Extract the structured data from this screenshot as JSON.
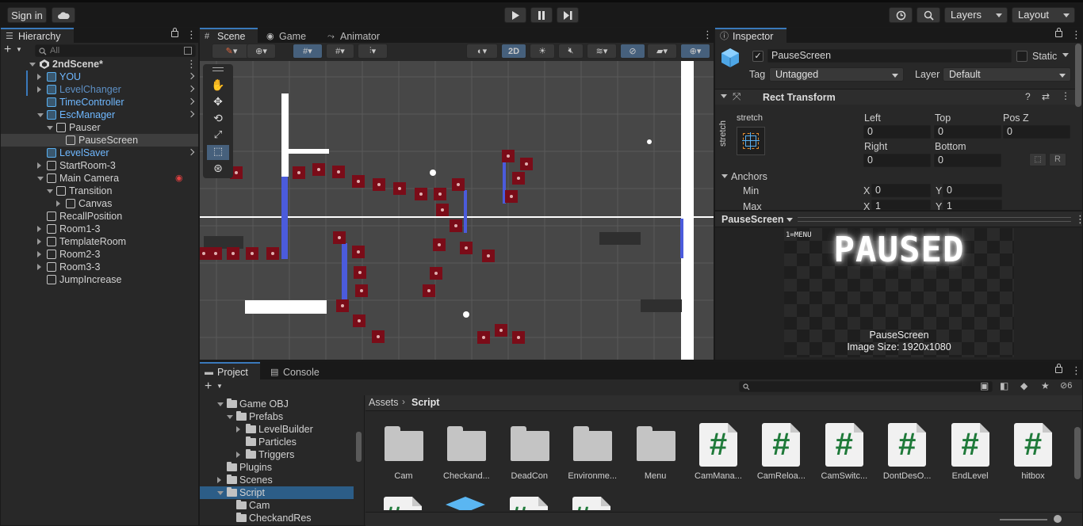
{
  "toolbar": {
    "sign_in": "Sign in",
    "layers": "Layers",
    "layout": "Layout"
  },
  "hierarchy": {
    "tab": "Hierarchy",
    "search_placeholder": "All",
    "scene_name": "2ndScene*",
    "items": [
      {
        "label": "YOU",
        "color": "blue"
      },
      {
        "label": "LevelChanger",
        "color": "faded"
      },
      {
        "label": "TimeController",
        "color": "blue"
      },
      {
        "label": "EscManager",
        "color": "blue"
      },
      {
        "label": "Pauser"
      },
      {
        "label": "PauseScreen"
      },
      {
        "label": "LevelSaver",
        "color": "blue"
      },
      {
        "label": "StartRoom-3"
      },
      {
        "label": "Main Camera"
      },
      {
        "label": "Transition"
      },
      {
        "label": "Canvas"
      },
      {
        "label": "RecallPosition"
      },
      {
        "label": "Room1-3"
      },
      {
        "label": "TemplateRoom"
      },
      {
        "label": "Room2-3"
      },
      {
        "label": "Room3-3"
      },
      {
        "label": "JumpIncrease"
      }
    ]
  },
  "scene": {
    "tabs": [
      "Scene",
      "Game",
      "Animator"
    ],
    "mode_2d": "2D"
  },
  "inspector": {
    "tab": "Inspector",
    "object_name": "PauseScreen",
    "static_label": "Static",
    "tag_label": "Tag",
    "tag_value": "Untagged",
    "layer_label": "Layer",
    "layer_value": "Default",
    "component": "Rect Transform",
    "stretch_label": "stretch",
    "fields": {
      "left_label": "Left",
      "left": "0",
      "top_label": "Top",
      "top": "0",
      "posz_label": "Pos Z",
      "posz": "0",
      "right_label": "Right",
      "right": "0",
      "bottom_label": "Bottom",
      "bottom": "0"
    },
    "anchors": "Anchors",
    "min_label": "Min",
    "max_label": "Max",
    "min_x": "0",
    "min_y": "0",
    "max_x": "1",
    "max_y": "1",
    "x_label": "X",
    "y_label": "Y",
    "r_btn": "R"
  },
  "preview": {
    "title": "PauseScreen",
    "menu_hint": "1=MENU",
    "paused_text": "PAUSED",
    "caption": "PauseScreen",
    "image_size": "Image Size: 1920x1080"
  },
  "project": {
    "tab": "Project",
    "console_tab": "Console",
    "hidden_count": "6",
    "breadcrumb_root": "Assets",
    "breadcrumb_current": "Script",
    "tree": [
      {
        "label": "Game OBJ",
        "indent": 1,
        "open": true
      },
      {
        "label": "Prefabs",
        "indent": 2,
        "open": true
      },
      {
        "label": "LevelBuilder",
        "indent": 3,
        "open": false
      },
      {
        "label": "Particles",
        "indent": 3,
        "leaf": true
      },
      {
        "label": "Triggers",
        "indent": 3,
        "open": false
      },
      {
        "label": "Plugins",
        "indent": 1,
        "leaf": true
      },
      {
        "label": "Scenes",
        "indent": 1,
        "open": false
      },
      {
        "label": "Script",
        "indent": 1,
        "open": true,
        "sel": true
      },
      {
        "label": "Cam",
        "indent": 2,
        "leaf": true
      },
      {
        "label": "CheckandRes",
        "indent": 2,
        "leaf": true
      }
    ],
    "assets": [
      {
        "label": "Cam",
        "kind": "folder"
      },
      {
        "label": "Checkand...",
        "kind": "folder"
      },
      {
        "label": "DeadCon",
        "kind": "folder"
      },
      {
        "label": "Environme...",
        "kind": "folder"
      },
      {
        "label": "Menu",
        "kind": "folder"
      },
      {
        "label": "CamMana...",
        "kind": "script"
      },
      {
        "label": "CamReloa...",
        "kind": "script"
      },
      {
        "label": "CamSwitc...",
        "kind": "script"
      },
      {
        "label": "DontDesO...",
        "kind": "script"
      },
      {
        "label": "EndLevel",
        "kind": "script"
      },
      {
        "label": "hitbox",
        "kind": "script"
      }
    ]
  },
  "colors": {
    "accent": "#3a79bb",
    "selection": "#2c5d87",
    "enemy": "#7a0c18"
  }
}
